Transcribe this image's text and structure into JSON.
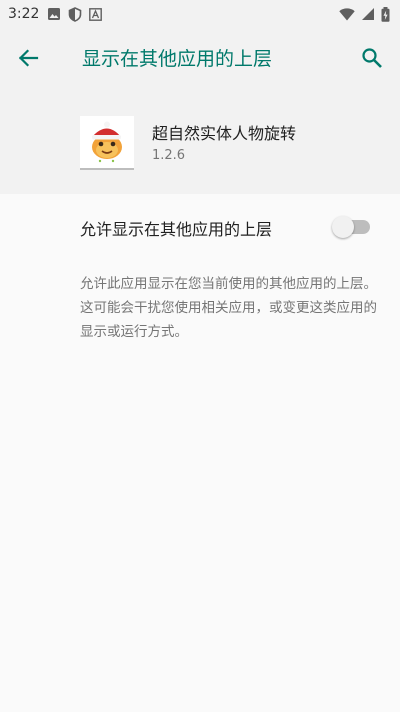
{
  "status_bar": {
    "time": "3:22",
    "left_icons": [
      "image-icon",
      "shield-icon",
      "a-box-icon"
    ],
    "right_icons": [
      "wifi-icon",
      "signal-icon",
      "battery-charging-icon"
    ]
  },
  "app_bar": {
    "title": "显示在其他应用的上层",
    "accent_color": "#00796b"
  },
  "app_info": {
    "name": "超自然实体人物旋转",
    "version": "1.2.6"
  },
  "setting": {
    "label": "允许显示在其他应用的上层",
    "enabled": false
  },
  "description": "允许此应用显示在您当前使用的其他应用的上层。这可能会干扰您使用相关应用，或变更这类应用的显示或运行方式。"
}
